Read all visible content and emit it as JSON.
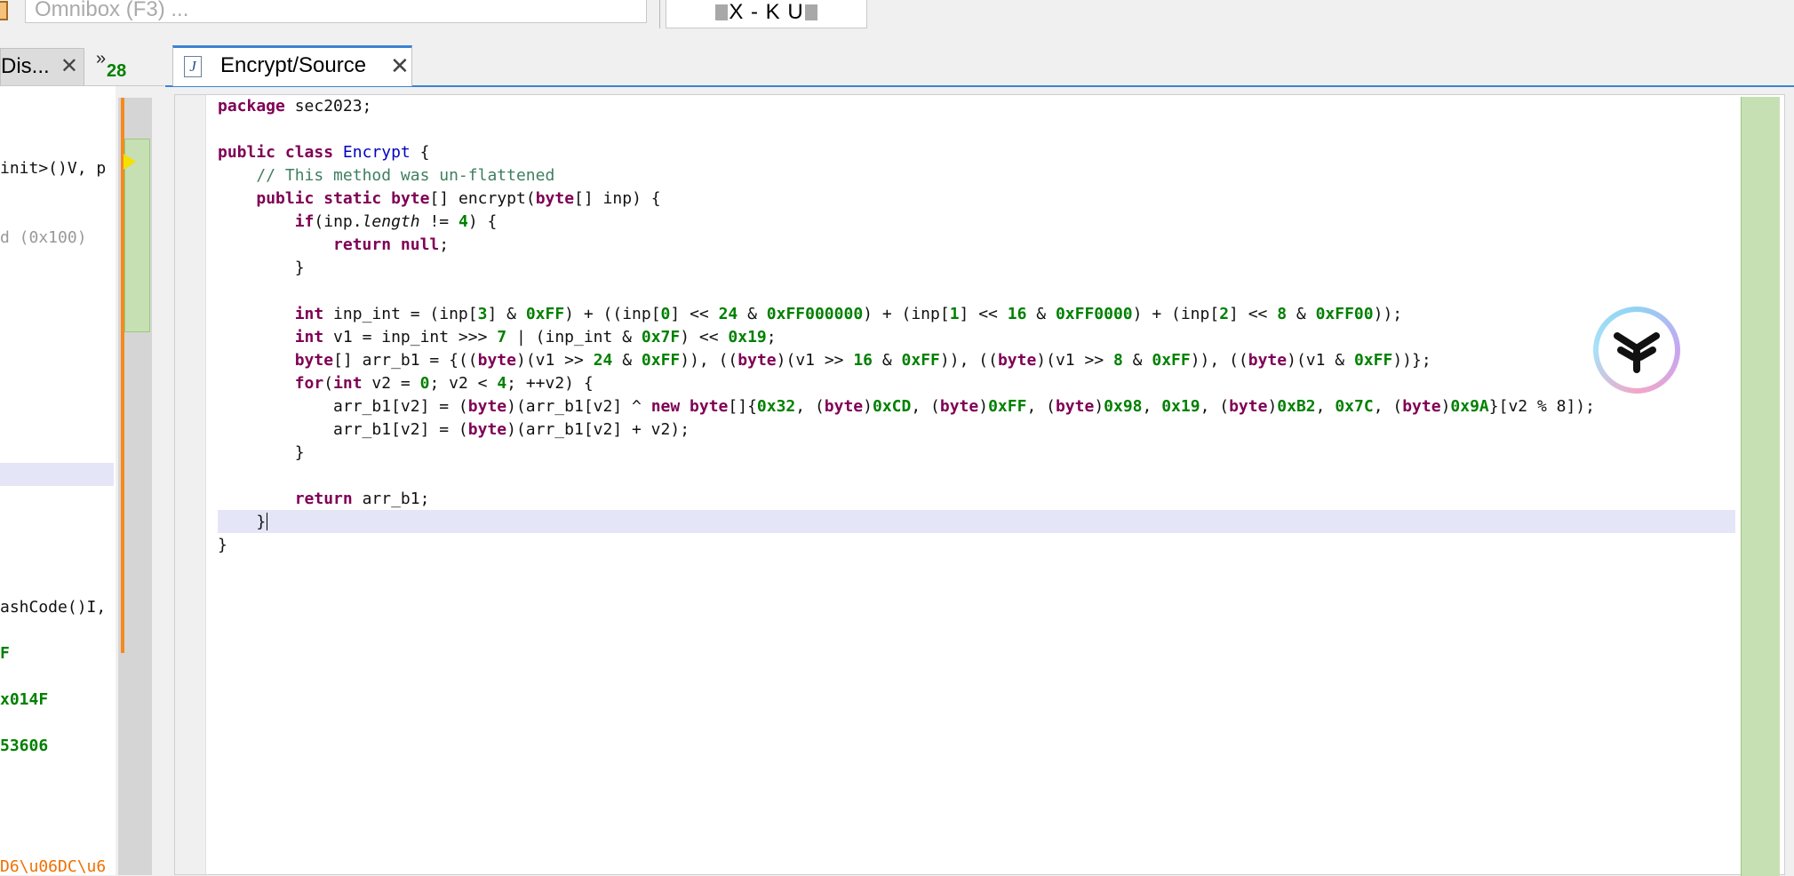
{
  "toolbar": {
    "omnibox_placeholder": "Omnibox (F3) ...",
    "redacted_text": "X - K U"
  },
  "left_pane": {
    "tab_label": "Dis...",
    "tab_close": "✕",
    "more_chevron": "»",
    "more_count": "28",
    "lines": [
      "init>()V, p",
      "d (0x100)",
      "ashCode()I,",
      "F",
      "x014F",
      "53606",
      "D6\\u06DC\\u6"
    ]
  },
  "editor": {
    "tab_icon_letter": "J",
    "tab_label": "Encrypt/Source",
    "tab_close": "✕"
  },
  "code": {
    "package_kw": "package",
    "package_name": " sec2023;",
    "l3": {
      "public": "public",
      "class": "class",
      "name": "Encrypt",
      "brace": " {"
    },
    "comment": "// This method was un-flattened",
    "l5": {
      "public": "public",
      "static": "static",
      "byte": "byte",
      "rest1": "[] encrypt(",
      "byte2": "byte",
      "rest2": "[] inp) {"
    },
    "l6": {
      "if": "if",
      "a": "(inp.",
      "length": "length",
      "b": " != ",
      "n4": "4",
      "c": ") {"
    },
    "l7": {
      "return": "return",
      "null": "null",
      "semi": ";"
    },
    "close_brace": "}",
    "l10": {
      "int": "int",
      "a": " inp_int = (inp[",
      "n3": "3",
      "b": "] & ",
      "ff1": "0xFF",
      "c": ") + ((inp[",
      "n0": "0",
      "d": "] << ",
      "n24": "24",
      "e": " & ",
      "ff000000": "0xFF000000",
      "f": ") + (inp[",
      "n1": "1",
      "g": "] << ",
      "n16": "16",
      "h": " & ",
      "ff0000": "0xFF0000",
      "i": ") + (inp[",
      "n2": "2",
      "j": "] << ",
      "n8": "8",
      "k": " & ",
      "ff00": "0xFF00",
      "l": "));"
    },
    "l11": {
      "int": "int",
      "a": " v1 = inp_int >>> ",
      "n7": "7",
      "b": " | (inp_int & ",
      "x7f": "0x7F",
      "c": ") << ",
      "x19": "0x19",
      "d": ";"
    },
    "l12": {
      "byte": "byte",
      "a": "[] arr_b1 = {((",
      "b1": "byte",
      "b": ")(v1 >> ",
      "n24": "24",
      "c": " & ",
      "ff1": "0xFF",
      "d": ")), ((",
      "b2": "byte",
      "e": ")(v1 >> ",
      "n16": "16",
      "f": " & ",
      "ff2": "0xFF",
      "g": ")), ((",
      "b3": "byte",
      "h": ")(v1 >> ",
      "n8": "8",
      "i": " & ",
      "ff3": "0xFF",
      "j": ")), ((",
      "b4": "byte",
      "k": ")(v1 & ",
      "ff4": "0xFF",
      "l": "))};"
    },
    "l13": {
      "for": "for",
      "a": "(",
      "int": "int",
      "b": " v2 = ",
      "n0": "0",
      "c": "; v2 < ",
      "n4": "4",
      "d": "; ++v2) {"
    },
    "l14": {
      "a": "arr_b1[v2] = (",
      "byte": "byte",
      "b": ")(arr_b1[v2] ^ ",
      "new": "new",
      "c": " ",
      "byte2": "byte",
      "d": "[]{",
      "x32": "0x32",
      "e": ", (",
      "b1": "byte",
      "f": ")",
      "xcd": "0xCD",
      "g": ", (",
      "b2": "byte",
      "h": ")",
      "xff": "0xFF",
      "i": ", (",
      "b3": "byte",
      "j": ")",
      "x98": "0x98",
      "k": ", ",
      "x19": "0x19",
      "l": ", (",
      "b4": "byte",
      "m": ")",
      "xb2": "0xB2",
      "n": ", ",
      "x7c": "0x7C",
      "o": ", (",
      "b5": "byte",
      "p": ")",
      "x9a": "0x9A",
      "q": "}[v2 % 8]);"
    },
    "l15": {
      "a": "arr_b1[v2] = (",
      "byte": "byte",
      "b": ")(arr_b1[v2] + v2);"
    },
    "l18": {
      "return": "return",
      "a": " arr_b1;"
    }
  },
  "colors": {
    "keyword": "#7f0055",
    "class_name": "#0000c0",
    "number": "#008000",
    "comment": "#3f7f5f",
    "highlight_line": "#e4e6f7",
    "tab_accent": "#3c83d2",
    "overview_green": "#c6e0b4",
    "change_bar_orange": "#f58a1e"
  },
  "icons": {
    "file_tab_icon": "java-file-icon",
    "badge": "y-logo-badge-icon"
  }
}
